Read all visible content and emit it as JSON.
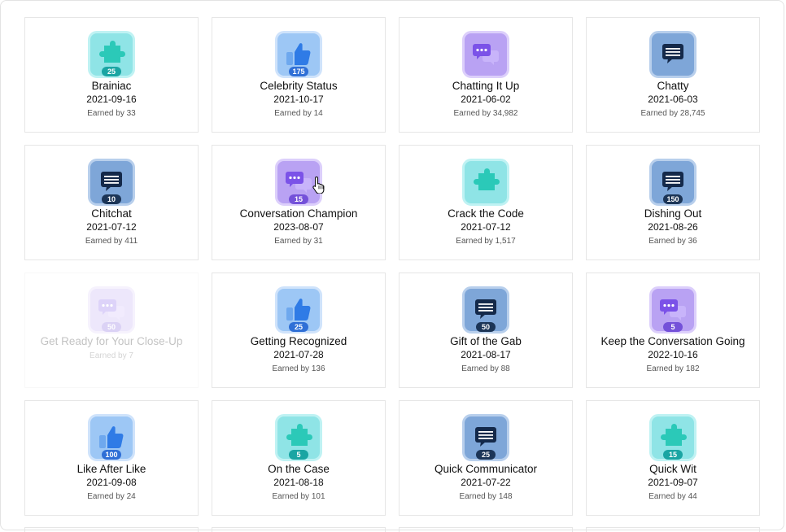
{
  "colors": {
    "teal": "#8fe4e6",
    "blue": "#9dc7f5",
    "purple": "#b9a2f3",
    "navy": "#7ea6d8",
    "card_border": "#e6e6e6"
  },
  "badges": [
    {
      "name": "Brainiac",
      "date": "2021-09-16",
      "earned": "Earned by 33",
      "count": "25",
      "icon": "puzzle-icon",
      "theme": "teal",
      "locked": false
    },
    {
      "name": "Celebrity Status",
      "date": "2021-10-17",
      "earned": "Earned by 14",
      "count": "175",
      "icon": "thumbs-up-icon",
      "theme": "blue",
      "locked": false
    },
    {
      "name": "Chatting It Up",
      "date": "2021-06-02",
      "earned": "Earned by 34,982",
      "count": "",
      "icon": "chat-bubbles-icon",
      "theme": "purple",
      "locked": false
    },
    {
      "name": "Chatty",
      "date": "2021-06-03",
      "earned": "Earned by 28,745",
      "count": "",
      "icon": "message-icon",
      "theme": "navy",
      "locked": false
    },
    {
      "name": "Chitchat",
      "date": "2021-07-12",
      "earned": "Earned by 411",
      "count": "10",
      "icon": "message-icon",
      "theme": "navy",
      "locked": false
    },
    {
      "name": "Conversation Champion",
      "date": "2023-08-07",
      "earned": "Earned by 31",
      "count": "15",
      "icon": "chat-bubbles-icon",
      "theme": "purple",
      "locked": false
    },
    {
      "name": "Crack the Code",
      "date": "2021-07-12",
      "earned": "Earned by 1,517",
      "count": "",
      "icon": "puzzle-icon",
      "theme": "teal",
      "locked": false
    },
    {
      "name": "Dishing Out",
      "date": "2021-08-26",
      "earned": "Earned by 36",
      "count": "150",
      "icon": "message-icon",
      "theme": "navy",
      "locked": false
    },
    {
      "name": "Get Ready for Your Close-Up",
      "date": "",
      "earned": "Earned by 7",
      "count": "50",
      "icon": "chat-bubbles-icon",
      "theme": "purple",
      "locked": true
    },
    {
      "name": "Getting Recognized",
      "date": "2021-07-28",
      "earned": "Earned by 136",
      "count": "25",
      "icon": "thumbs-up-icon",
      "theme": "blue",
      "locked": false
    },
    {
      "name": "Gift of the Gab",
      "date": "2021-08-17",
      "earned": "Earned by 88",
      "count": "50",
      "icon": "message-icon",
      "theme": "navy",
      "locked": false
    },
    {
      "name": "Keep the Conversation Going",
      "date": "2022-10-16",
      "earned": "Earned by 182",
      "count": "5",
      "icon": "chat-bubbles-icon",
      "theme": "purple",
      "locked": false
    },
    {
      "name": "Like After Like",
      "date": "2021-09-08",
      "earned": "Earned by 24",
      "count": "100",
      "icon": "thumbs-up-icon",
      "theme": "blue",
      "locked": false
    },
    {
      "name": "On the Case",
      "date": "2021-08-18",
      "earned": "Earned by 101",
      "count": "5",
      "icon": "puzzle-icon",
      "theme": "teal",
      "locked": false
    },
    {
      "name": "Quick Communicator",
      "date": "2021-07-22",
      "earned": "Earned by 148",
      "count": "25",
      "icon": "message-icon",
      "theme": "navy",
      "locked": false
    },
    {
      "name": "Quick Wit",
      "date": "2021-09-07",
      "earned": "Earned by 44",
      "count": "15",
      "icon": "puzzle-icon",
      "theme": "teal",
      "locked": false
    }
  ]
}
